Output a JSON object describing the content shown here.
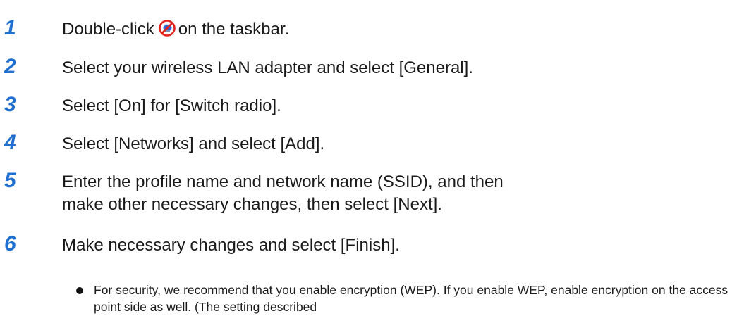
{
  "steps": [
    {
      "number": "1",
      "text_before": "Double-click",
      "icon": "wireless-network-disabled-icon",
      "text_after": "on the taskbar."
    },
    {
      "number": "2",
      "text": "Select your wireless LAN adapter and select [General]."
    },
    {
      "number": "3",
      "text": "Select [On] for [Switch radio]."
    },
    {
      "number": "4",
      "text": "Select [Networks] and select [Add]."
    },
    {
      "number": "5",
      "text": "Enter the profile name and network name (SSID), and then make other necessary changes, then select [Next]."
    },
    {
      "number": "6",
      "text": "Make necessary changes and select [Finish]."
    }
  ],
  "note": {
    "text": "For security, we recommend that you enable encryption (WEP). If you enable WEP, enable encryption on the access point side as well. (The setting described"
  },
  "colors": {
    "step_number": "#1f6fd0",
    "body_text": "#1a1a1a",
    "icon_red": "#e0241b",
    "icon_blue": "#2a63d6"
  }
}
